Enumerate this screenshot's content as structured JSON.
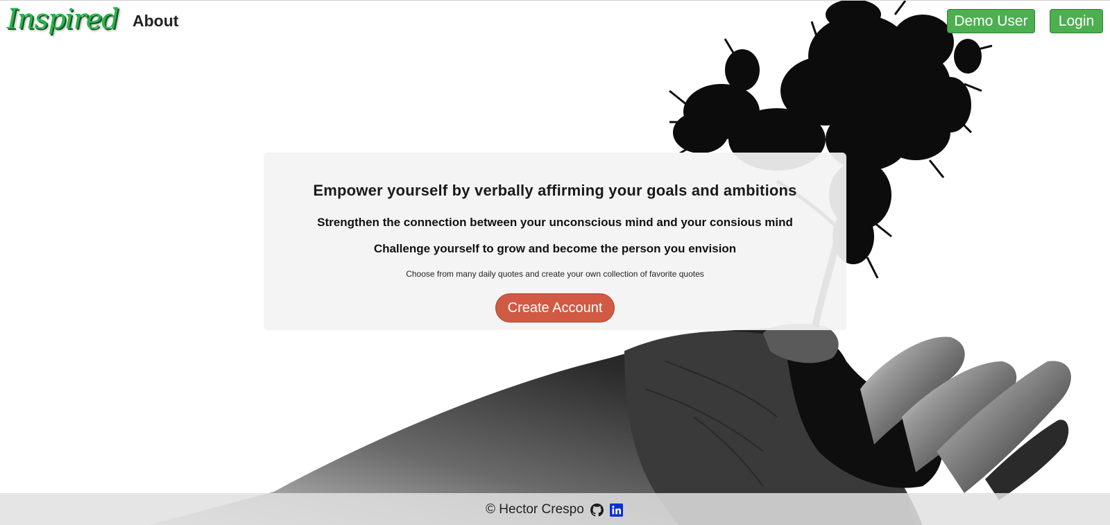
{
  "nav": {
    "logo": "Inspired",
    "about": "About",
    "demo_user": "Demo User",
    "login": "Login"
  },
  "hero": {
    "headline": "Empower yourself by verbally affirming your goals and ambitions",
    "line2": "Strengthen the connection between your unconscious mind and your consious mind",
    "line3": "Challenge yourself to grow and become the person you envision",
    "small": "Choose from many daily quotes and create your own collection of favorite quotes",
    "cta": "Create Account"
  },
  "footer": {
    "copyright": "© Hector Crespo",
    "icons": [
      "github-icon",
      "linkedin-icon"
    ]
  },
  "colors": {
    "accent_green": "#4caf50",
    "logo_green": "#2bb34a",
    "cta": "#d05a43",
    "linkedin": "#0a2fd6"
  }
}
